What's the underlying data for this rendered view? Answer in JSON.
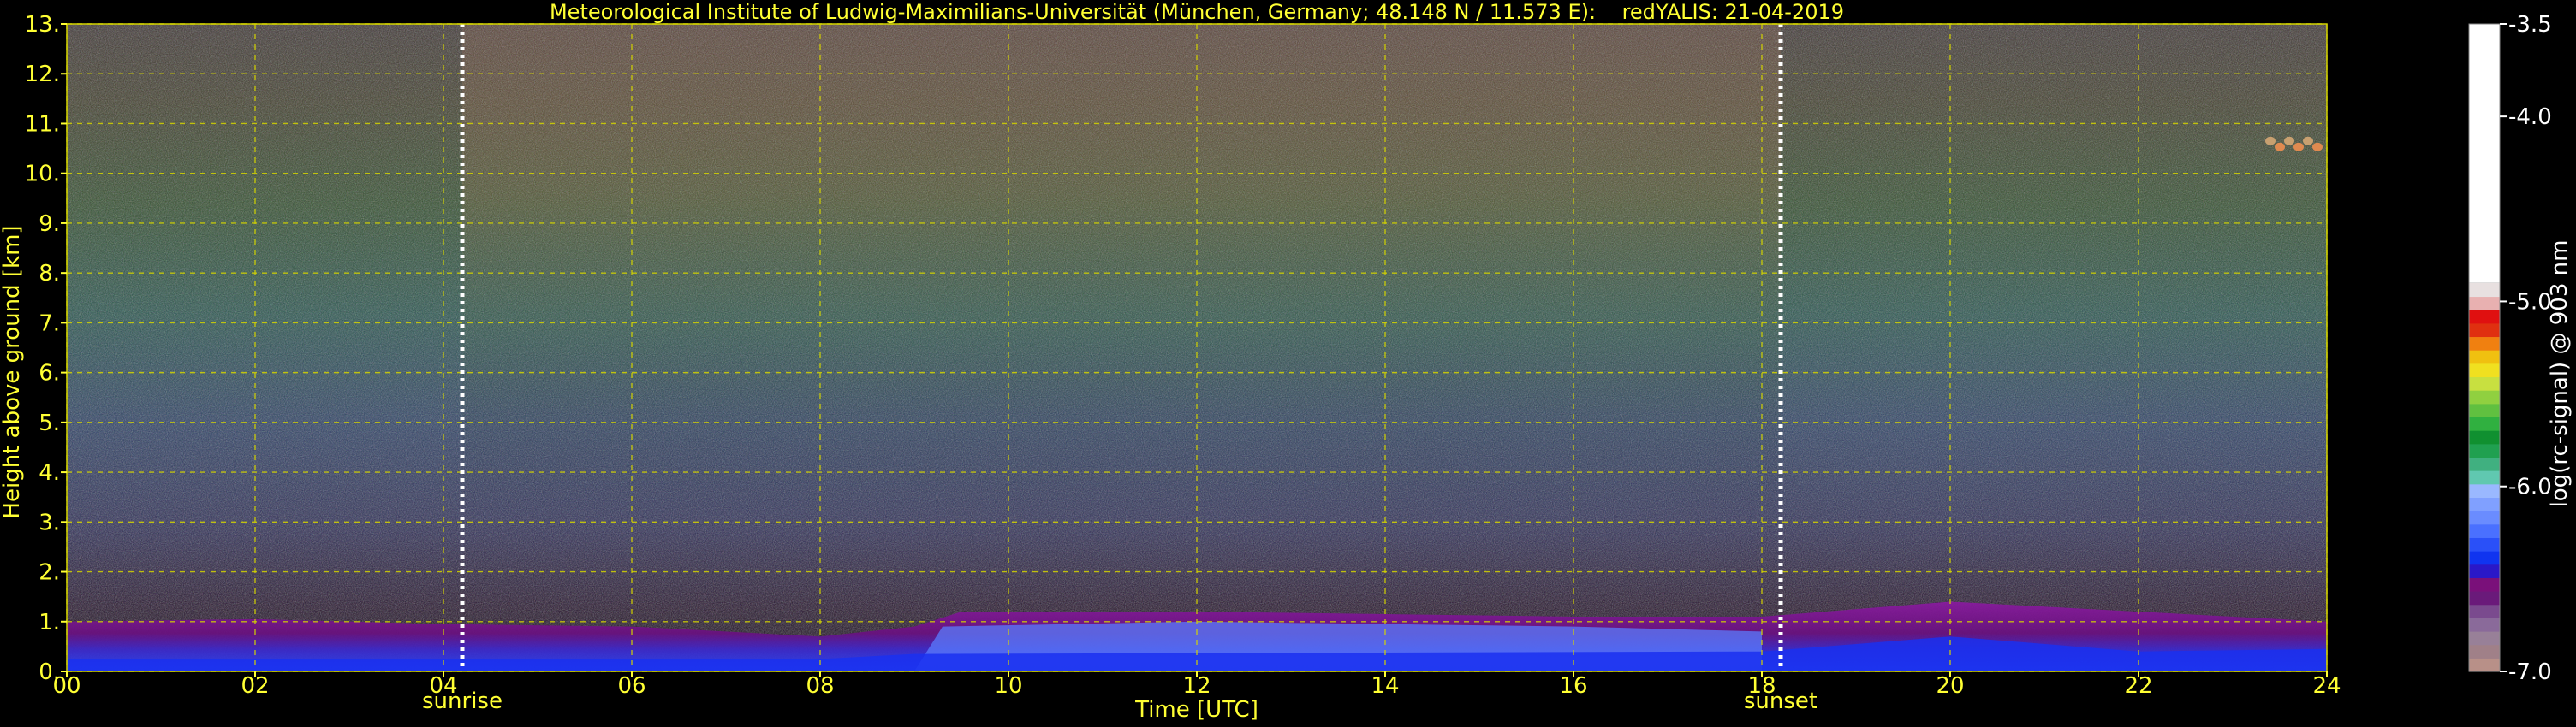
{
  "chart_data": {
    "type": "heatmap",
    "title": "Meteorological Institute of Ludwig-Maximilians-Universität (München, Germany; 48.148 N / 11.573 E):    redYALIS: 21-04-2019",
    "xlabel": "Time [UTC]",
    "ylabel": "Height above ground [km]",
    "xlim": [
      0,
      24
    ],
    "ylim": [
      0,
      13
    ],
    "x_ticks": [
      0,
      2,
      4,
      6,
      8,
      10,
      12,
      14,
      16,
      18,
      20,
      22,
      24
    ],
    "x_tick_labels": [
      "00",
      "02",
      "04",
      "06",
      "08",
      "10",
      "12",
      "14",
      "16",
      "18",
      "20",
      "22",
      "24"
    ],
    "y_ticks": [
      0,
      1,
      2,
      3,
      4,
      5,
      6,
      7,
      8,
      9,
      10,
      11,
      12,
      13
    ],
    "y_tick_labels": [
      "0.",
      "1.",
      "2.",
      "3.",
      "4.",
      "5.",
      "6.",
      "7.",
      "8.",
      "9.",
      "10.",
      "11.",
      "12.",
      "13."
    ],
    "grid": true,
    "grid_color": "#d4d400",
    "annotations": [
      {
        "label": "sunrise",
        "x": 4.2
      },
      {
        "label": "sunset",
        "x": 18.2
      }
    ],
    "boundary_layer_top_km": [
      {
        "t": 0,
        "h": 1.0
      },
      {
        "t": 2,
        "h": 1.05
      },
      {
        "t": 4,
        "h": 0.95
      },
      {
        "t": 6,
        "h": 0.9
      },
      {
        "t": 8,
        "h": 0.7
      },
      {
        "t": 9,
        "h": 0.9
      },
      {
        "t": 9.5,
        "h": 1.2
      },
      {
        "t": 12,
        "h": 1.2
      },
      {
        "t": 14,
        "h": 1.15
      },
      {
        "t": 16,
        "h": 1.1
      },
      {
        "t": 18,
        "h": 1.1
      },
      {
        "t": 20,
        "h": 1.4
      },
      {
        "t": 22,
        "h": 1.2
      },
      {
        "t": 24,
        "h": 1.0
      }
    ],
    "cloud_patch": {
      "t_start": 23.4,
      "t_end": 24,
      "h_start": 10.5,
      "h_end": 10.7
    },
    "colorbar": {
      "label": "log(rc-signal) @ 903 nm",
      "range": [
        -7.0,
        -3.5
      ],
      "tick_values": [
        -3.5,
        -4.0,
        -5.0,
        -6.0,
        -7.0
      ],
      "tick_labels": [
        "-3.5",
        "-4.0",
        "-5.0",
        "-6.0",
        "-7.0"
      ],
      "colors": [
        "#b89088",
        "#a08088",
        "#988098",
        "#8a6a9a",
        "#7a4a8e",
        "#6a1a7a",
        "#7a107a",
        "#2a18c8",
        "#1034f0",
        "#2a50f8",
        "#4a70ff",
        "#6a8cff",
        "#80a0ff",
        "#9ab8ff",
        "#60c8b0",
        "#40b080",
        "#20a050",
        "#109030",
        "#30b040",
        "#60c040",
        "#90d040",
        "#c8e040",
        "#f0e020",
        "#f0c010",
        "#f08010",
        "#e03010",
        "#e01010",
        "#e8b0b0",
        "#e8e0e0",
        "#ffffff"
      ]
    }
  }
}
